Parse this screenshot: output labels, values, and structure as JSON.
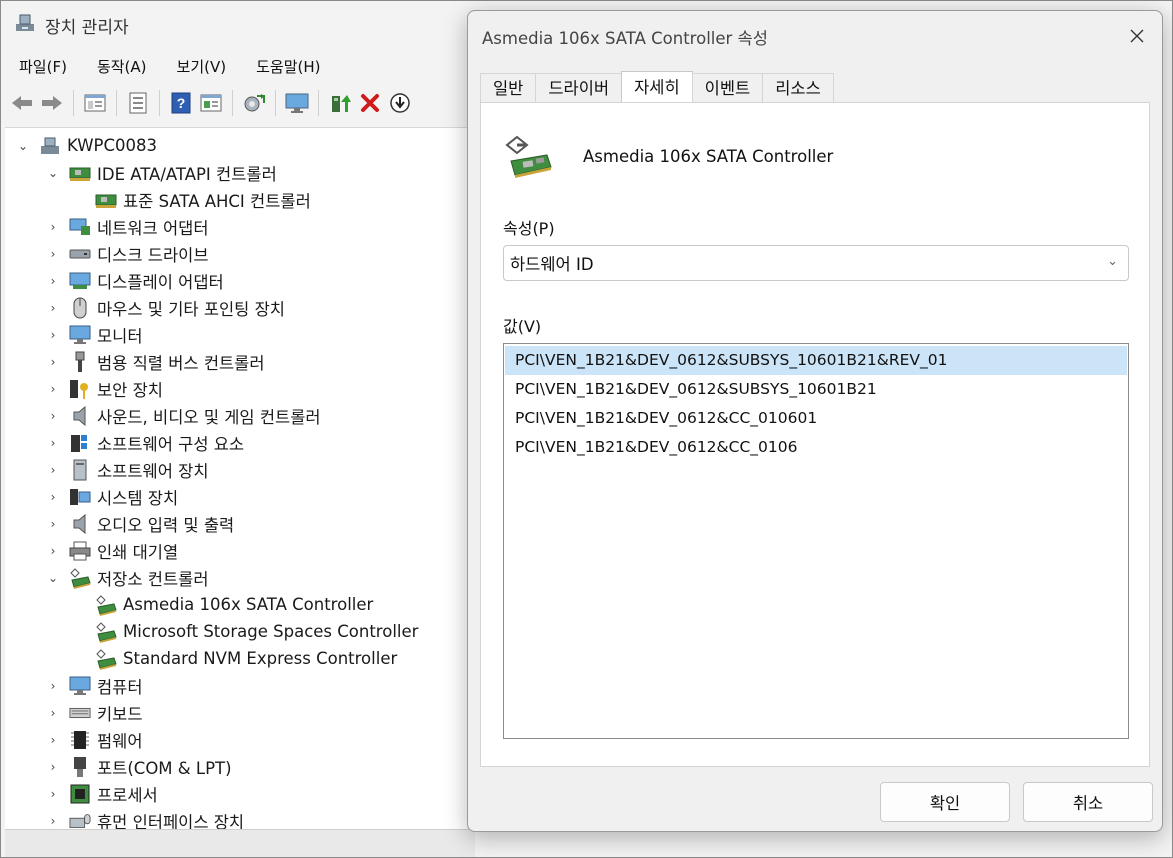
{
  "device_manager": {
    "title": "장치 관리자",
    "menus": [
      "파일(F)",
      "동작(A)",
      "보기(V)",
      "도움말(H)"
    ],
    "toolbar_icons": [
      "back-arrow-icon",
      "forward-arrow-icon",
      "show-hide-tree-icon",
      "properties-icon",
      "help-icon",
      "driver-details-icon",
      "scan-hardware-icon",
      "monitor-icon",
      "update-driver-icon",
      "uninstall-icon",
      "disable-device-icon"
    ],
    "tree": [
      {
        "label": "KWPC0083",
        "level": 0,
        "state": "expanded",
        "icon": "computer-icon"
      },
      {
        "label": "IDE ATA/ATAPI 컨트롤러",
        "level": 1,
        "state": "expanded",
        "icon": "ide-controller-icon"
      },
      {
        "label": "표준 SATA AHCI 컨트롤러",
        "level": 2,
        "state": "leaf",
        "icon": "ide-controller-icon"
      },
      {
        "label": "네트워크 어댑터",
        "level": 1,
        "state": "collapsed",
        "icon": "network-adapter-icon"
      },
      {
        "label": "디스크 드라이브",
        "level": 1,
        "state": "collapsed",
        "icon": "disk-drive-icon"
      },
      {
        "label": "디스플레이 어댑터",
        "level": 1,
        "state": "collapsed",
        "icon": "display-adapter-icon"
      },
      {
        "label": "마우스 및 기타 포인팅 장치",
        "level": 1,
        "state": "collapsed",
        "icon": "mouse-icon"
      },
      {
        "label": "모니터",
        "level": 1,
        "state": "collapsed",
        "icon": "monitor-icon"
      },
      {
        "label": "범용 직렬 버스 컨트롤러",
        "level": 1,
        "state": "collapsed",
        "icon": "usb-icon"
      },
      {
        "label": "보안 장치",
        "level": 1,
        "state": "collapsed",
        "icon": "security-key-icon"
      },
      {
        "label": "사운드, 비디오 및 게임 컨트롤러",
        "level": 1,
        "state": "collapsed",
        "icon": "speaker-icon"
      },
      {
        "label": "소프트웨어 구성 요소",
        "level": 1,
        "state": "collapsed",
        "icon": "software-component-icon"
      },
      {
        "label": "소프트웨어 장치",
        "level": 1,
        "state": "collapsed",
        "icon": "software-device-icon"
      },
      {
        "label": "시스템 장치",
        "level": 1,
        "state": "collapsed",
        "icon": "system-device-icon"
      },
      {
        "label": "오디오 입력 및 출력",
        "level": 1,
        "state": "collapsed",
        "icon": "speaker-icon"
      },
      {
        "label": "인쇄 대기열",
        "level": 1,
        "state": "collapsed",
        "icon": "printer-icon"
      },
      {
        "label": "저장소 컨트롤러",
        "level": 1,
        "state": "expanded",
        "icon": "storage-controller-icon"
      },
      {
        "label": "Asmedia 106x SATA Controller",
        "level": 2,
        "state": "leaf",
        "icon": "storage-controller-icon"
      },
      {
        "label": "Microsoft Storage Spaces Controller",
        "level": 2,
        "state": "leaf",
        "icon": "storage-controller-icon"
      },
      {
        "label": "Standard NVM Express Controller",
        "level": 2,
        "state": "leaf",
        "icon": "storage-controller-icon"
      },
      {
        "label": "컴퓨터",
        "level": 1,
        "state": "collapsed",
        "icon": "monitor-icon"
      },
      {
        "label": "키보드",
        "level": 1,
        "state": "collapsed",
        "icon": "keyboard-icon"
      },
      {
        "label": "펌웨어",
        "level": 1,
        "state": "collapsed",
        "icon": "firmware-chip-icon"
      },
      {
        "label": "포트(COM & LPT)",
        "level": 1,
        "state": "collapsed",
        "icon": "port-icon"
      },
      {
        "label": "프로세서",
        "level": 1,
        "state": "collapsed",
        "icon": "processor-icon"
      },
      {
        "label": "휴먼 인터페이스 장치",
        "level": 1,
        "state": "collapsed",
        "icon": "hid-icon"
      }
    ]
  },
  "dialog": {
    "title": "Asmedia 106x SATA Controller 속성",
    "tabs": [
      "일반",
      "드라이버",
      "자세히",
      "이벤트",
      "리소스"
    ],
    "active_tab": "자세히",
    "device_name": "Asmedia 106x SATA Controller",
    "property_label": "속성(P)",
    "property_value": "하드웨어 ID",
    "value_label": "값(V)",
    "values": [
      "PCI\\VEN_1B21&DEV_0612&SUBSYS_10601B21&REV_01",
      "PCI\\VEN_1B21&DEV_0612&SUBSYS_10601B21",
      "PCI\\VEN_1B21&DEV_0612&CC_010601",
      "PCI\\VEN_1B21&DEV_0612&CC_0106"
    ],
    "selected_value_index": 0,
    "ok_label": "확인",
    "cancel_label": "취소"
  }
}
